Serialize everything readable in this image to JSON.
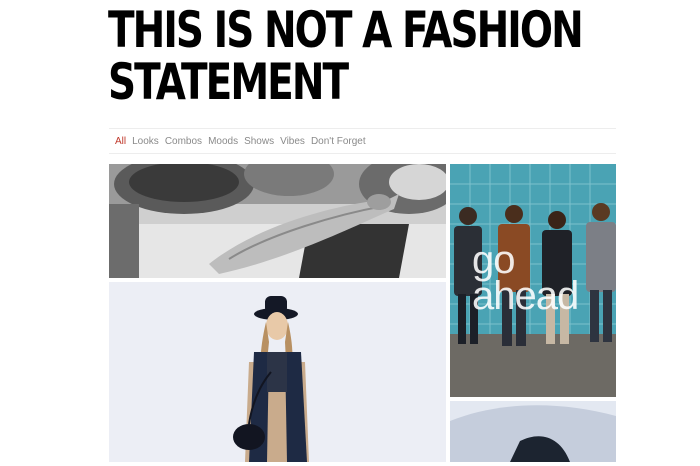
{
  "site": {
    "title_line1": "THIS IS NOT A FASHION",
    "title_line2": "STATEMENT"
  },
  "filters": [
    {
      "label": "All",
      "active": true
    },
    {
      "label": "Looks",
      "active": false
    },
    {
      "label": "Combos",
      "active": false
    },
    {
      "label": "Moods",
      "active": false
    },
    {
      "label": "Shows",
      "active": false
    },
    {
      "label": "Vibes",
      "active": false
    },
    {
      "label": "Don't Forget",
      "active": false
    }
  ],
  "tiles": {
    "band_overlay_line1": "go",
    "band_overlay_line2": "ahead"
  },
  "colors": {
    "accent": "#c0392b",
    "filter_text": "#8a8a8a",
    "title": "#000000"
  }
}
